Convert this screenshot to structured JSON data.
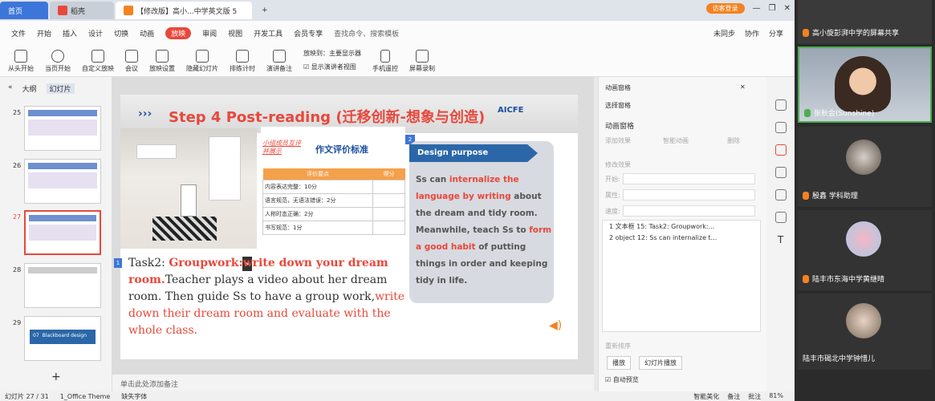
{
  "tabs": {
    "home": "首页",
    "straw": "稻壳",
    "doc": "【修改版】高小...中学英文版 5",
    "add": "+"
  },
  "window": {
    "login": "访客登录"
  },
  "menu": {
    "file": "文件",
    "items": [
      "开始",
      "插入",
      "设计",
      "切换",
      "动画"
    ],
    "selected": "放映",
    "items2": [
      "审阅",
      "视图",
      "开发工具",
      "会员专享"
    ],
    "search": "查找命令、搜索模板",
    "sync": "未同步",
    "collab": "协作",
    "share": "分享"
  },
  "ribbon": {
    "from_start": "从头开始",
    "from_current": "当页开始",
    "custom": "自定义放映",
    "meeting": "会议",
    "setup": "放映设置",
    "hide": "隐藏幻灯片",
    "rehearse": "排练计时",
    "notes": "演讲备注",
    "play_to": "放映到：",
    "monitor": "主要显示器",
    "presenter": "显示演讲者视图",
    "phone": "手机遥控",
    "record": "屏幕录制"
  },
  "leftpane": {
    "outline": "大纲",
    "slides": "幻灯片",
    "slide_numbers": [
      "25",
      "26",
      "27",
      "28",
      "29"
    ],
    "thumb29_num": "07",
    "thumb29_title": "Blackboard design"
  },
  "slide": {
    "arrows": "›››",
    "title": "Step 4  Post-reading (迁移创新-想象与创造)",
    "aicfe": "AICFE",
    "rubric_hand": "小组成员互评并展示",
    "rubric_title": "作文评价标准",
    "rubric_cols": [
      "评价要点",
      "得分"
    ],
    "rubric_rows": [
      "内容表达完整：10分",
      "语言规范，无语法错误：2分",
      "人称时态正确：2分",
      "书写规范：1分"
    ],
    "badge2": "2",
    "badge1": "1",
    "purpose_title": "Design purpose",
    "purpose_p1": "Ss can ",
    "purpose_red1": "internalize the language by writing",
    "purpose_p2": " about the dream and tidy room. Meanwhile, teach Ss to ",
    "purpose_red2": "form a good habit",
    "purpose_p3": " of putting things in order and keeping tidy in life.",
    "task_prefix": "Task2: ",
    "task_red1": "Groupwork:write down your dream room.",
    "task_mid": "Teacher plays a video about her dream room. Then guide Ss to have a group work,",
    "task_red2": "write down their dream room and evaluate with the whole class."
  },
  "notes": "单击此处添加备注",
  "animpane": {
    "title": "动画窗格",
    "select_pane": "选择窗格",
    "anim_pane": "动画窗格",
    "add_effect": "添加效果",
    "smart": "智能动画",
    "delete": "删除",
    "modify": "修改效果",
    "start": "开始:",
    "property": "属性:",
    "speed": "速度:",
    "items": [
      "1  文本框 15: Task2: Groupwork:...",
      "2  object 12: Ss can internalize t..."
    ],
    "reorder": "重新排序",
    "play": "播放",
    "slideshow": "幻灯片播放",
    "autopreview": "自动预览"
  },
  "status": {
    "slide": "幻灯片 27 / 31",
    "theme": "1_Office Theme",
    "font": "缺失字体",
    "beautify": "智能美化",
    "notes": "备注",
    "comments": "批注",
    "zoom": "81%"
  },
  "meeting": {
    "share": "高小旋彭湃中学的屏幕共享",
    "p1": "张秋会(Sunshine)",
    "p2": "殷鑫 学科助理",
    "p3": "陆丰市东海中学黄继晴",
    "p4": "陆丰市碣北中学钟惜儿"
  },
  "colors": {
    "accent": "#e8483b",
    "blue": "#1a4fa0",
    "orange": "#f58220"
  }
}
